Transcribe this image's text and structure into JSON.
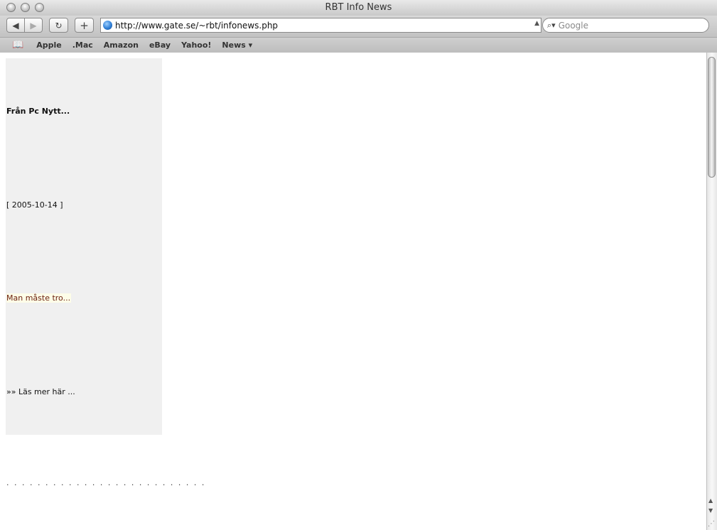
{
  "window": {
    "title": "RBT Info News"
  },
  "toolbar": {
    "back_glyph": "◀",
    "forward_glyph": "▶",
    "reload_glyph": "↻",
    "add_glyph": "+",
    "url": "http://www.gate.se/~rbt/infonews.php",
    "search_placeholder": "Google"
  },
  "bookmarks": {
    "book_glyph": "📖",
    "items": [
      "Apple",
      ".Mac",
      "Amazon",
      "eBay",
      "Yahoo!",
      "News ▾"
    ]
  },
  "news": {
    "title": "Från Pc Nytt...",
    "date": "[ 2005-10-14 ]",
    "excerpt": "Man måste tro...",
    "link": "»»  Läs mer här ...",
    "separator": ". . . . . . . . . . . . . . . . . . . . . . . . . ."
  },
  "colors": {
    "panel_bg": "#f0f0f0",
    "excerpt_text": "#6b1e0d"
  }
}
